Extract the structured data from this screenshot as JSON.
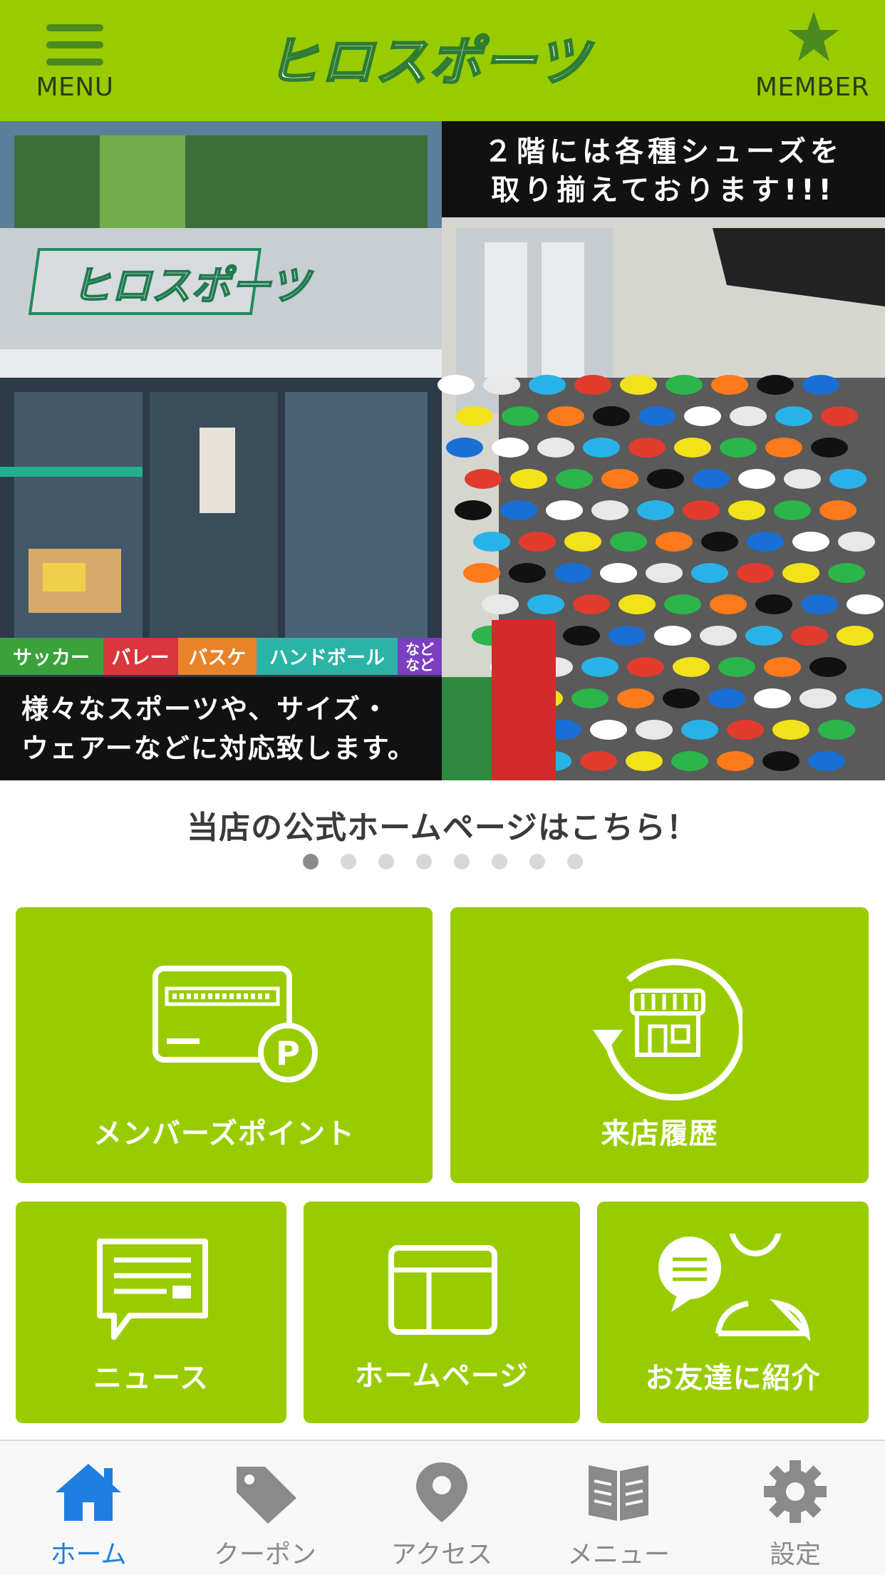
{
  "header": {
    "menu_label": "MENU",
    "member_label": "MEMBER",
    "logo_text": "ヒロスポーツ"
  },
  "banner": {
    "right_caption_line1": "２階には各種シューズを",
    "right_caption_line2": "取り揃えております!!!",
    "store_sign": "ヒロスポーツ",
    "sport_tags": [
      "サッカー",
      "バレー",
      "バスケ",
      "ハンドボール"
    ],
    "etc_tag_line1": "など",
    "etc_tag_line2": "など",
    "left_caption_line1": "様々なスポーツや、サイズ・",
    "left_caption_line2": "ウェアーなどに対応致します。"
  },
  "caption": {
    "text": "当店の公式ホームページはこちら！",
    "slide_count": 8,
    "active_slide": 1
  },
  "tiles": {
    "points": "メンバーズポイント",
    "history": "来店履歴",
    "news": "ニュース",
    "homepage": "ホームページ",
    "refer": "お友達に紹介"
  },
  "tabs": [
    {
      "label": "ホーム",
      "icon": "home-icon"
    },
    {
      "label": "クーポン",
      "icon": "tag-icon"
    },
    {
      "label": "アクセス",
      "icon": "location-pin-icon"
    },
    {
      "label": "メニュー",
      "icon": "book-icon"
    },
    {
      "label": "設定",
      "icon": "gear-icon"
    }
  ],
  "colors": {
    "brand_green": "#99cc00",
    "active_tab": "#1e7fe0",
    "inactive_tab": "#8a8a8a"
  }
}
